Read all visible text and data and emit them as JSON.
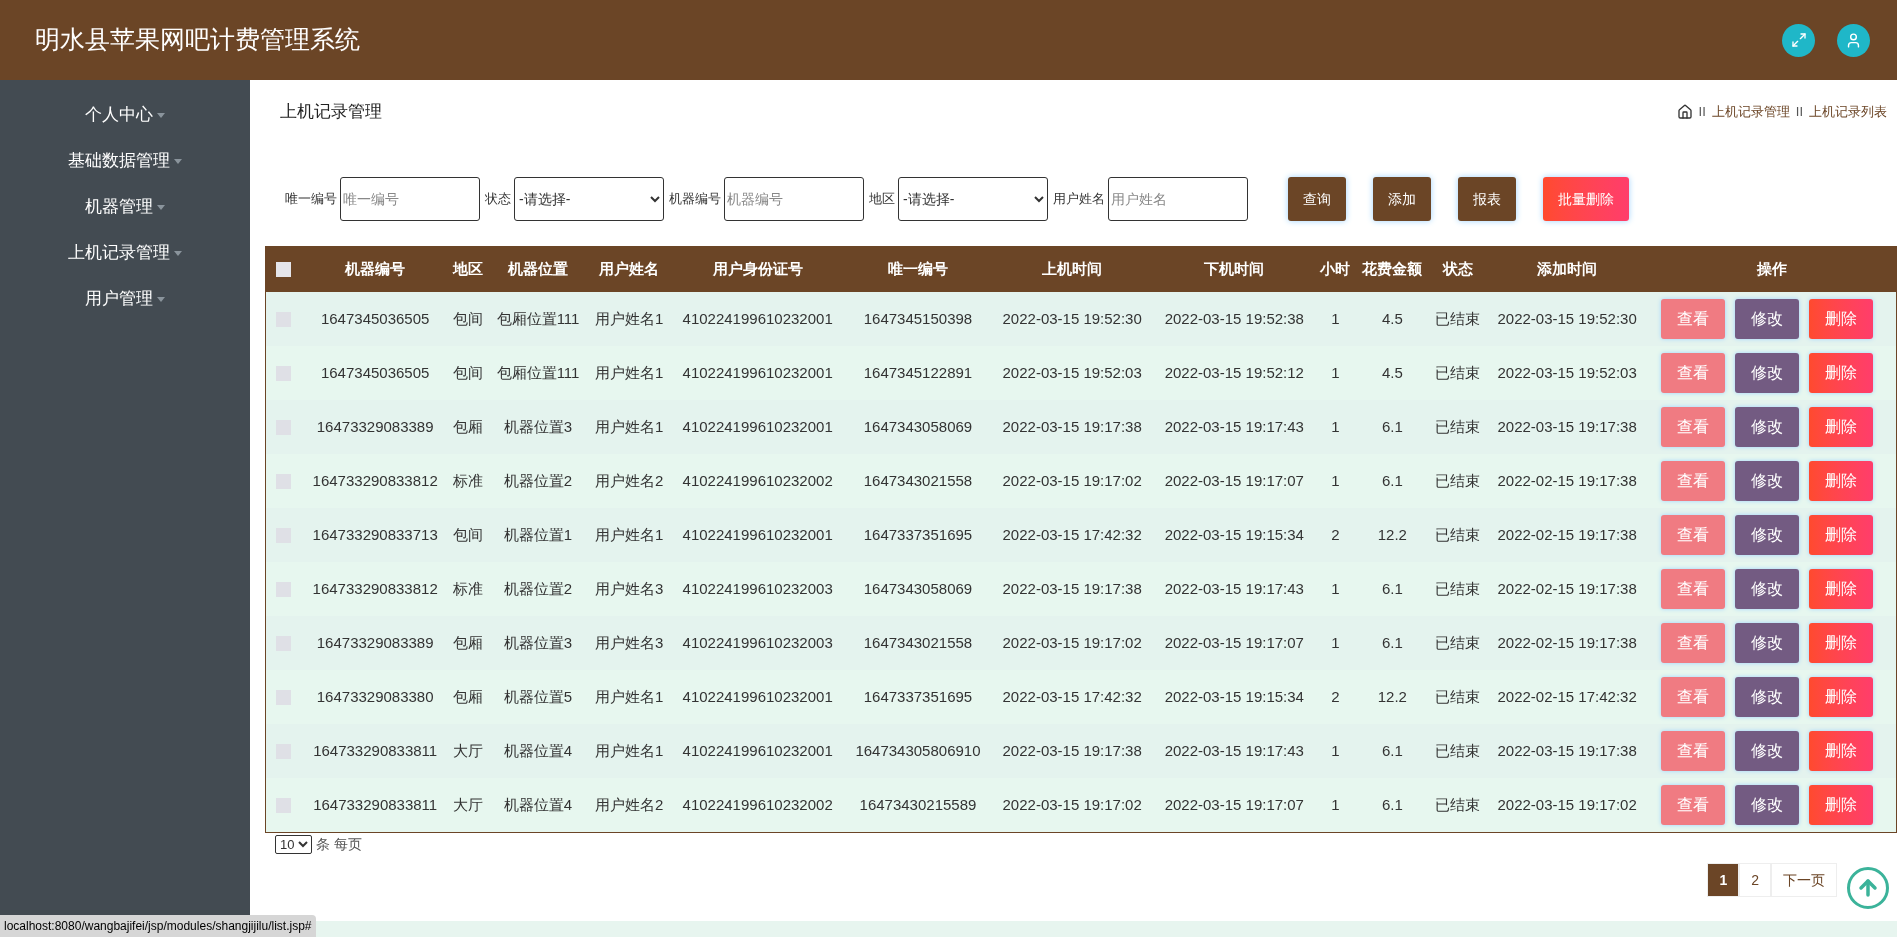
{
  "header": {
    "title": "明水县苹果网吧计费管理系统"
  },
  "sidebar": {
    "items": [
      {
        "label": "个人中心"
      },
      {
        "label": "基础数据管理"
      },
      {
        "label": "机器管理"
      },
      {
        "label": "上机记录管理"
      },
      {
        "label": "用户管理"
      }
    ]
  },
  "page": {
    "title": "上机记录管理",
    "breadcrumb": [
      {
        "separator": "II",
        "label": "上机记录管理"
      },
      {
        "separator": "II",
        "label": "上机记录列表"
      }
    ]
  },
  "filters": [
    {
      "kind": "input",
      "label": "唯一编号",
      "placeholder": "唯一编号"
    },
    {
      "kind": "select",
      "label": "状态",
      "value": "-请选择-"
    },
    {
      "kind": "input",
      "label": "机器编号",
      "placeholder": "机器编号"
    },
    {
      "kind": "select",
      "label": "地区",
      "value": "-请选择-"
    },
    {
      "kind": "input",
      "label": "用户姓名",
      "placeholder": "用户姓名"
    }
  ],
  "actions": [
    {
      "kind": "normal",
      "label": "查询"
    },
    {
      "kind": "normal",
      "label": "添加"
    },
    {
      "kind": "normal",
      "label": "报表"
    },
    {
      "kind": "danger",
      "label": "批量删除"
    }
  ],
  "table": {
    "select_all": {
      "checked": false
    },
    "columns": [
      "机器编号",
      "地区",
      "机器位置",
      "用户姓名",
      "用户身份证号",
      "唯一编号",
      "上机时间",
      "下机时间",
      "小时",
      "花费金额",
      "状态",
      "添加时间",
      "操作"
    ],
    "rows": [
      {
        "checked": false,
        "cells": [
          "1647345036505",
          "包间",
          "包厢位置111",
          "用户姓名1",
          "410224199610232001",
          "1647345150398",
          "2022-03-15 19:52:30",
          "2022-03-15 19:52:38",
          "1",
          "4.5",
          "已结束",
          "2022-03-15 19:52:30"
        ],
        "actions": [
          {
            "kind": "view",
            "label": "查看"
          },
          {
            "kind": "edit",
            "label": "修改"
          },
          {
            "kind": "delete",
            "label": "删除"
          }
        ]
      },
      {
        "checked": false,
        "cells": [
          "1647345036505",
          "包间",
          "包厢位置111",
          "用户姓名1",
          "410224199610232001",
          "1647345122891",
          "2022-03-15 19:52:03",
          "2022-03-15 19:52:12",
          "1",
          "4.5",
          "已结束",
          "2022-03-15 19:52:03"
        ],
        "actions": [
          {
            "kind": "view",
            "label": "查看"
          },
          {
            "kind": "edit",
            "label": "修改"
          },
          {
            "kind": "delete",
            "label": "删除"
          }
        ]
      },
      {
        "checked": false,
        "cells": [
          "16473329083389",
          "包厢",
          "机器位置3",
          "用户姓名1",
          "410224199610232001",
          "1647343058069",
          "2022-03-15 19:17:38",
          "2022-03-15 19:17:43",
          "1",
          "6.1",
          "已结束",
          "2022-03-15 19:17:38"
        ],
        "actions": [
          {
            "kind": "view",
            "label": "查看"
          },
          {
            "kind": "edit",
            "label": "修改"
          },
          {
            "kind": "delete",
            "label": "删除"
          }
        ]
      },
      {
        "checked": false,
        "cells": [
          "164733290833812",
          "标准",
          "机器位置2",
          "用户姓名2",
          "410224199610232002",
          "1647343021558",
          "2022-03-15 19:17:02",
          "2022-03-15 19:17:07",
          "1",
          "6.1",
          "已结束",
          "2022-02-15 19:17:38"
        ],
        "actions": [
          {
            "kind": "view",
            "label": "查看"
          },
          {
            "kind": "edit",
            "label": "修改"
          },
          {
            "kind": "delete",
            "label": "删除"
          }
        ]
      },
      {
        "checked": false,
        "cells": [
          "164733290833713",
          "包间",
          "机器位置1",
          "用户姓名1",
          "410224199610232001",
          "1647337351695",
          "2022-03-15 17:42:32",
          "2022-03-15 19:15:34",
          "2",
          "12.2",
          "已结束",
          "2022-02-15 19:17:38"
        ],
        "actions": [
          {
            "kind": "view",
            "label": "查看"
          },
          {
            "kind": "edit",
            "label": "修改"
          },
          {
            "kind": "delete",
            "label": "删除"
          }
        ]
      },
      {
        "checked": false,
        "cells": [
          "164733290833812",
          "标准",
          "机器位置2",
          "用户姓名3",
          "410224199610232003",
          "1647343058069",
          "2022-03-15 19:17:38",
          "2022-03-15 19:17:43",
          "1",
          "6.1",
          "已结束",
          "2022-02-15 19:17:38"
        ],
        "actions": [
          {
            "kind": "view",
            "label": "查看"
          },
          {
            "kind": "edit",
            "label": "修改"
          },
          {
            "kind": "delete",
            "label": "删除"
          }
        ]
      },
      {
        "checked": false,
        "cells": [
          "16473329083389",
          "包厢",
          "机器位置3",
          "用户姓名3",
          "410224199610232003",
          "1647343021558",
          "2022-03-15 19:17:02",
          "2022-03-15 19:17:07",
          "1",
          "6.1",
          "已结束",
          "2022-02-15 19:17:38"
        ],
        "actions": [
          {
            "kind": "view",
            "label": "查看"
          },
          {
            "kind": "edit",
            "label": "修改"
          },
          {
            "kind": "delete",
            "label": "删除"
          }
        ]
      },
      {
        "checked": false,
        "cells": [
          "16473329083380",
          "包厢",
          "机器位置5",
          "用户姓名1",
          "410224199610232001",
          "1647337351695",
          "2022-03-15 17:42:32",
          "2022-03-15 19:15:34",
          "2",
          "12.2",
          "已结束",
          "2022-02-15 17:42:32"
        ],
        "actions": [
          {
            "kind": "view",
            "label": "查看"
          },
          {
            "kind": "edit",
            "label": "修改"
          },
          {
            "kind": "delete",
            "label": "删除"
          }
        ]
      },
      {
        "checked": false,
        "cells": [
          "164733290833811",
          "大厅",
          "机器位置4",
          "用户姓名1",
          "410224199610232001",
          "164734305806910",
          "2022-03-15 19:17:38",
          "2022-03-15 19:17:43",
          "1",
          "6.1",
          "已结束",
          "2022-03-15 19:17:38"
        ],
        "actions": [
          {
            "kind": "view",
            "label": "查看"
          },
          {
            "kind": "edit",
            "label": "修改"
          },
          {
            "kind": "delete",
            "label": "删除"
          }
        ]
      },
      {
        "checked": false,
        "cells": [
          "164733290833811",
          "大厅",
          "机器位置4",
          "用户姓名2",
          "410224199610232002",
          "16473430215589",
          "2022-03-15 19:17:02",
          "2022-03-15 19:17:07",
          "1",
          "6.1",
          "已结束",
          "2022-03-15 19:17:02"
        ],
        "actions": [
          {
            "kind": "view",
            "label": "查看"
          },
          {
            "kind": "edit",
            "label": "修改"
          },
          {
            "kind": "delete",
            "label": "删除"
          }
        ]
      }
    ]
  },
  "page_size": {
    "value": "10",
    "suffix": "条 每页"
  },
  "pagination": [
    {
      "label": "1",
      "selected": true
    },
    {
      "label": "2",
      "selected": false
    },
    {
      "label": "下一页",
      "selected": false
    }
  ],
  "status_bar": {
    "url": "localhost:8080/wangbajifei/jsp/modules/shangjijilu/list.jsp#"
  }
}
